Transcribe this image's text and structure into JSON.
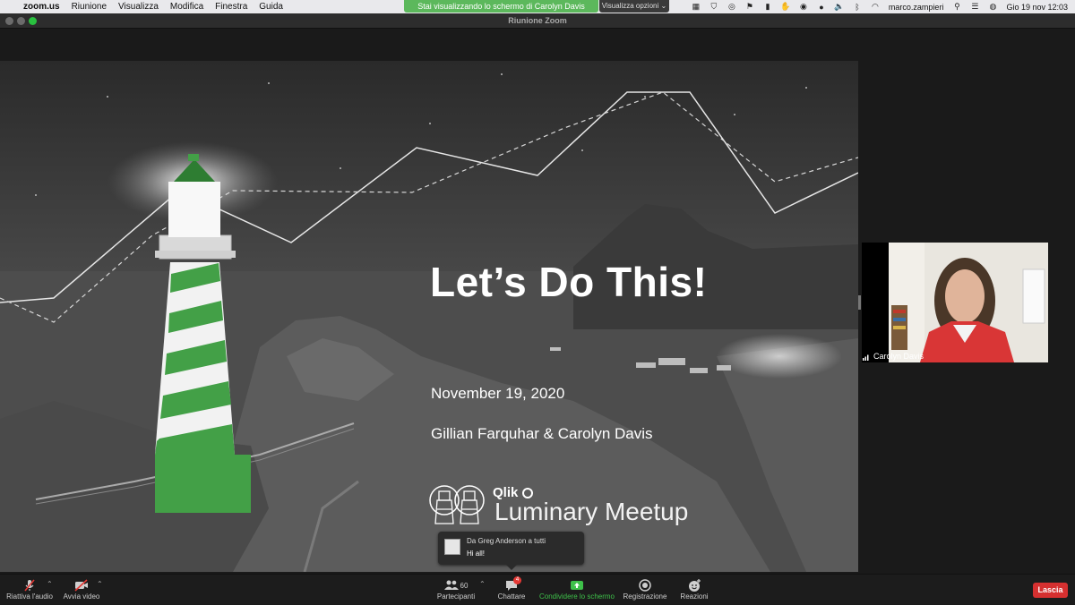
{
  "menubar": {
    "app": "zoom.us",
    "items": [
      "Riunione",
      "Visualizza",
      "Modifica",
      "Finestra",
      "Guida"
    ],
    "share_banner": "Stai visualizzando lo schermo di Carolyn Davis",
    "view_options": "Visualizza opzioni",
    "user": "marco.zampieri",
    "clock": "Gio 19 nov  12:03"
  },
  "window": {
    "title": "Riunione Zoom"
  },
  "slide": {
    "title": "Let’s Do This!",
    "date": "November 19, 2020",
    "authors": "Gillian Farquhar & Carolyn Davis",
    "brand": "Qlik",
    "event": "Luminary Meetup"
  },
  "participant": {
    "name": "Carolyn Davis"
  },
  "chat": {
    "from": "Da Greg Anderson a tutti",
    "message": "Hi all!"
  },
  "toolbar": {
    "unmute": "Riattiva l'audio",
    "start_video": "Avvia video",
    "participants": "Partecipanti",
    "participants_count": "60",
    "chat": "Chattare",
    "chat_badge": "4",
    "share": "Condividere lo schermo",
    "record": "Registrazione",
    "reactions": "Reazioni",
    "leave": "Lascia"
  },
  "colors": {
    "accent_green": "#3ec14a",
    "leave_red": "#d63030",
    "lighthouse_green": "#43a047"
  }
}
